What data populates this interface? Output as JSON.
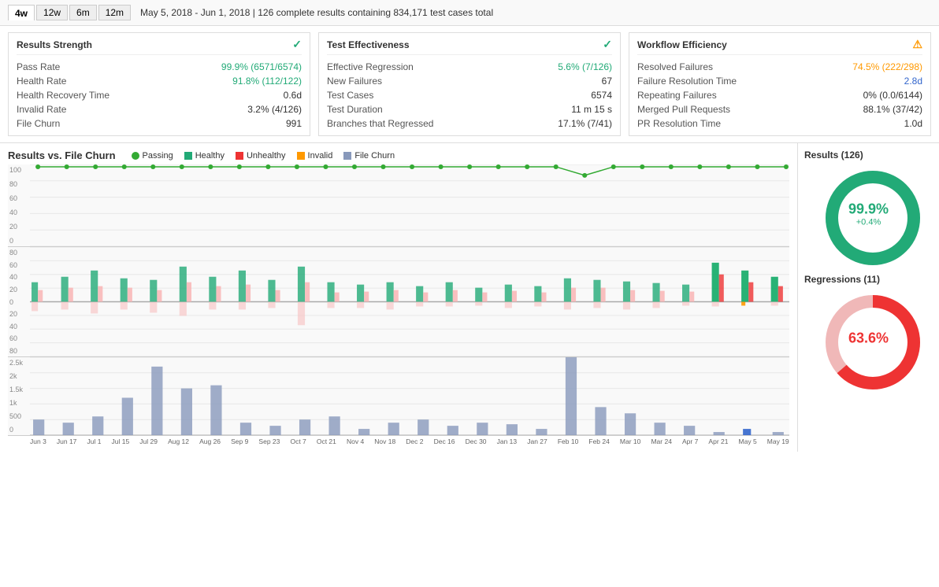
{
  "topbar": {
    "time_buttons": [
      "4w",
      "12w",
      "6m",
      "12m"
    ],
    "active_button": "4w",
    "date_range": "May 5, 2018 - Jun 1, 2018 | 126 complete results containing 834,171 test cases total"
  },
  "cards": {
    "results_strength": {
      "title": "Results Strength",
      "icon": "✓",
      "icon_class": "green",
      "rows": [
        {
          "label": "Pass Rate",
          "value": "99.9% (6571/6574)",
          "value_class": "green"
        },
        {
          "label": "Health Rate",
          "value": "91.8% (112/122)",
          "value_class": "green"
        },
        {
          "label": "Health Recovery Time",
          "value": "0.6d",
          "value_class": ""
        },
        {
          "label": "Invalid Rate",
          "value": "3.2% (4/126)",
          "value_class": ""
        },
        {
          "label": "File Churn",
          "value": "991",
          "value_class": ""
        }
      ]
    },
    "test_effectiveness": {
      "title": "Test Effectiveness",
      "icon": "✓",
      "icon_class": "green",
      "rows": [
        {
          "label": "Effective Regression",
          "value": "5.6% (7/126)",
          "value_class": "green"
        },
        {
          "label": "New Failures",
          "value": "67",
          "value_class": ""
        },
        {
          "label": "Test Cases",
          "value": "6574",
          "value_class": ""
        },
        {
          "label": "Test Duration",
          "value": "11 m 15 s",
          "value_class": ""
        },
        {
          "label": "Branches that Regressed",
          "value": "17.1% (7/41)",
          "value_class": ""
        }
      ]
    },
    "workflow_efficiency": {
      "title": "Workflow Efficiency",
      "icon": "⚠",
      "icon_class": "orange",
      "rows": [
        {
          "label": "Resolved Failures",
          "value": "74.5% (222/298)",
          "value_class": "orange"
        },
        {
          "label": "Failure Resolution Time",
          "value": "2.8d",
          "value_class": "blue"
        },
        {
          "label": "Repeating Failures",
          "value": "0% (0.0/6144)",
          "value_class": ""
        },
        {
          "label": "Merged Pull Requests",
          "value": "88.1% (37/42)",
          "value_class": ""
        },
        {
          "label": "PR Resolution Time",
          "value": "1.0d",
          "value_class": ""
        }
      ]
    }
  },
  "chart": {
    "title": "Results vs. File Churn",
    "legend": [
      {
        "label": "Passing",
        "color": "#3a3",
        "shape": "dot"
      },
      {
        "label": "Healthy",
        "color": "#2a7",
        "shape": "sq"
      },
      {
        "label": "Unhealthy",
        "color": "#e33",
        "shape": "sq"
      },
      {
        "label": "Invalid",
        "color": "#f90",
        "shape": "sq"
      },
      {
        "label": "File Churn",
        "color": "#89b",
        "shape": "sq"
      }
    ],
    "line_chart_y_labels": [
      "100",
      "80",
      "60",
      "40",
      "20",
      "0"
    ],
    "bar_chart_y_labels": [
      "80",
      "60",
      "40",
      "20",
      "0",
      "20",
      "40",
      "60",
      "80"
    ],
    "churn_chart_y_labels": [
      "2.5k",
      "2k",
      "1.5k",
      "1k",
      "500",
      "0"
    ],
    "x_labels": [
      "Jun 3",
      "Jun 17",
      "Jul 1",
      "Jul 15",
      "Jul 29",
      "Aug 12",
      "Aug 26",
      "Sep 9",
      "Sep 23",
      "Oct 7",
      "Oct 21",
      "Nov 4",
      "Nov 18",
      "Dec 2",
      "Dec 16",
      "Dec 30",
      "Jan 13",
      "Jan 27",
      "Feb 10",
      "Feb 24",
      "Mar 10",
      "Mar 24",
      "Apr 7",
      "Apr 21",
      "May 5",
      "May 19"
    ]
  },
  "results_donut": {
    "title": "Results (126)",
    "percentage": "99.9%",
    "subtitle": "+0.4%",
    "fill_color": "#2a7",
    "empty_color": "#ddd",
    "fill_pct": 99.9
  },
  "regressions_donut": {
    "title": "Regressions (11)",
    "percentage": "63.6%",
    "subtitle": "",
    "fill_color": "#e33",
    "empty_color": "#f0b8b8",
    "fill_pct": 63.6
  }
}
